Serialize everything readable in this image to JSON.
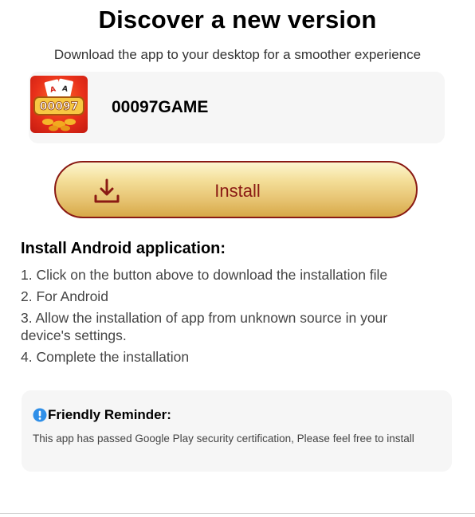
{
  "header": {
    "title": "Discover a new version",
    "subtitle": "Download the app to your desktop for a smoother experience"
  },
  "app": {
    "name": "00097GAME",
    "icon_text": "00097",
    "icon": "app-logo-icon"
  },
  "install_button": {
    "label": "Install",
    "icon": "download-icon"
  },
  "instructions": {
    "heading": "Install Android application:",
    "steps": [
      "1. Click on the button above to download the installation file",
      "2. For Android",
      "3. Allow the installation of app from unknown source in your device's settings.",
      "4. Complete the installation"
    ]
  },
  "reminder": {
    "title": "Friendly Reminder:",
    "text": "This app has passed Google Play security certification, Please feel free to install",
    "icon": "info-icon"
  },
  "colors": {
    "accent": "#8a1a14",
    "button_gold": "#e6c270",
    "info_blue": "#2f8fe8",
    "card_bg": "#f6f6f6"
  }
}
